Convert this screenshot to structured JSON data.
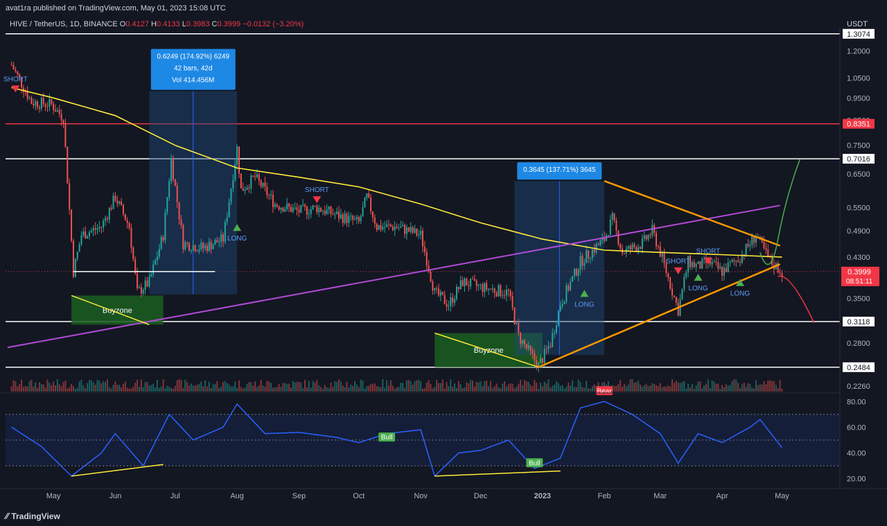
{
  "publish": {
    "text": "avat1ra published on TradingView.com, May 01, 2023 15:08 UTC"
  },
  "legend": {
    "symbol": "HIVE / TetherUS, 1D, BINANCE",
    "open_label": "O",
    "open": "0.4127",
    "high_label": "H",
    "high": "0.4133",
    "low_label": "L",
    "low": "0.3983",
    "close_label": "C",
    "close": "0.3999",
    "change": "−0.0132 (−3.20%)"
  },
  "currency": "USDT",
  "footer": {
    "brand": "TradingView",
    "logo_icon": "tradingview-logo-icon"
  },
  "colors": {
    "background": "#131722",
    "up": "#26a69a",
    "down": "#ef5350",
    "ema": "#ffeb3b",
    "trend_orange": "#ff9800",
    "trend_purple": "#b24bd6",
    "resistance": "#f23645",
    "rsi": "#2962ff"
  },
  "chart_data": [
    {
      "type": "candlestick",
      "title": "HIVE / TetherUS, 1D, BINANCE",
      "y_scale": "log",
      "ylim": [
        0.22,
        1.32
      ],
      "x_ticks": [
        "May",
        "Jun",
        "Jul",
        "Aug",
        "Sep",
        "Oct",
        "Nov",
        "Dec",
        "2023",
        "Feb",
        "Mar",
        "Apr",
        "May"
      ],
      "y_ticks": [
        "1.2000",
        "1.0500",
        "0.9500",
        "0.8500",
        "0.7500",
        "0.6500",
        "0.5500",
        "0.4900",
        "0.4300",
        "0.3500",
        "0.2800",
        "0.2260"
      ],
      "levels": [
        {
          "price": "1.3074",
          "value": 1.3074,
          "color": "#ffffff"
        },
        {
          "price": "0.8351",
          "value": 0.8351,
          "color": "#f23645"
        },
        {
          "price": "0.7016",
          "value": 0.7016,
          "color": "#ffffff"
        },
        {
          "price": "0.3118",
          "value": 0.3118,
          "color": "#ffffff"
        },
        {
          "price": "0.2484",
          "value": 0.2484,
          "color": "#ffffff"
        }
      ],
      "last_price": {
        "price": "0.3999",
        "countdown": "08:51:11"
      },
      "close_path": [
        [
          "2022-04-10",
          1.12
        ],
        [
          "2022-04-20",
          0.93
        ],
        [
          "2022-04-30",
          0.92
        ],
        [
          "2022-05-06",
          0.86
        ],
        [
          "2022-05-11",
          0.4
        ],
        [
          "2022-05-15",
          0.48
        ],
        [
          "2022-05-25",
          0.5
        ],
        [
          "2022-06-01",
          0.58
        ],
        [
          "2022-06-08",
          0.5
        ],
        [
          "2022-06-12",
          0.36
        ],
        [
          "2022-06-18",
          0.38
        ],
        [
          "2022-06-25",
          0.48
        ],
        [
          "2022-06-29",
          0.7
        ],
        [
          "2022-07-05",
          0.46
        ],
        [
          "2022-07-15",
          0.45
        ],
        [
          "2022-07-25",
          0.47
        ],
        [
          "2022-08-01",
          0.74
        ],
        [
          "2022-08-03",
          0.6
        ],
        [
          "2022-08-10",
          0.64
        ],
        [
          "2022-08-20",
          0.56
        ],
        [
          "2022-09-01",
          0.54
        ],
        [
          "2022-09-10",
          0.55
        ],
        [
          "2022-09-20",
          0.53
        ],
        [
          "2022-10-01",
          0.51
        ],
        [
          "2022-10-05",
          0.58
        ],
        [
          "2022-10-10",
          0.5
        ],
        [
          "2022-10-20",
          0.5
        ],
        [
          "2022-11-01",
          0.48
        ],
        [
          "2022-11-08",
          0.36
        ],
        [
          "2022-11-15",
          0.34
        ],
        [
          "2022-11-22",
          0.38
        ],
        [
          "2022-12-01",
          0.37
        ],
        [
          "2022-12-15",
          0.36
        ],
        [
          "2022-12-20",
          0.29
        ],
        [
          "2022-12-30",
          0.25
        ],
        [
          "2023-01-05",
          0.28
        ],
        [
          "2023-01-10",
          0.34
        ],
        [
          "2023-01-20",
          0.42
        ],
        [
          "2023-02-01",
          0.47
        ],
        [
          "2023-02-05",
          0.52
        ],
        [
          "2023-02-10",
          0.44
        ],
        [
          "2023-02-20",
          0.46
        ],
        [
          "2023-02-25",
          0.49
        ],
        [
          "2023-03-01",
          0.44
        ],
        [
          "2023-03-10",
          0.33
        ],
        [
          "2023-03-15",
          0.42
        ],
        [
          "2023-03-20",
          0.41
        ],
        [
          "2023-03-25",
          0.42
        ],
        [
          "2023-04-01",
          0.4
        ],
        [
          "2023-04-10",
          0.43
        ],
        [
          "2023-04-18",
          0.48
        ],
        [
          "2023-04-25",
          0.42
        ],
        [
          "2023-05-01",
          0.4
        ]
      ],
      "ema_yellow": [
        [
          "2022-04-10",
          1.0
        ],
        [
          "2022-05-01",
          0.95
        ],
        [
          "2022-06-01",
          0.87
        ],
        [
          "2022-07-01",
          0.75
        ],
        [
          "2022-08-01",
          0.67
        ],
        [
          "2022-09-01",
          0.64
        ],
        [
          "2022-10-01",
          0.61
        ],
        [
          "2022-11-01",
          0.56
        ],
        [
          "2022-12-01",
          0.51
        ],
        [
          "2023-01-01",
          0.47
        ],
        [
          "2023-02-01",
          0.445
        ],
        [
          "2023-03-01",
          0.44
        ],
        [
          "2023-04-01",
          0.435
        ],
        [
          "2023-05-01",
          0.43
        ]
      ],
      "measure_boxes": [
        {
          "label": "0.6249 (174.92%) 6249",
          "label2": "42 bars, 42d",
          "label3": "Vol 414.456M",
          "from": "2022-06-18",
          "to": "2022-08-01",
          "low": 0.357,
          "high": 0.982
        },
        {
          "label": "0.3645 (137.71%) 3645",
          "from": "2022-12-18",
          "to": "2023-02-01",
          "low": 0.264,
          "high": 0.628
        }
      ],
      "zones": [
        {
          "label": "Buyzone",
          "from": "2022-05-10",
          "to": "2022-06-25",
          "low": 0.307,
          "high": 0.355
        },
        {
          "label": "Buyzone",
          "from": "2022-11-08",
          "to": "2023-01-01",
          "low": 0.2484,
          "high": 0.2944
        }
      ],
      "signals": [
        {
          "label": "SHORT",
          "date": "2022-04-12",
          "price": 0.99,
          "dir": "down"
        },
        {
          "label": "LONG",
          "date": "2022-08-01",
          "price": 0.5,
          "dir": "up"
        },
        {
          "label": "SHORT",
          "date": "2022-09-10",
          "price": 0.57,
          "dir": "down"
        },
        {
          "label": "LONG",
          "date": "2023-01-22",
          "price": 0.36,
          "dir": "up"
        },
        {
          "label": "SHORT",
          "date": "2023-03-10",
          "price": 0.4,
          "dir": "down"
        },
        {
          "label": "LONG",
          "date": "2023-03-20",
          "price": 0.39,
          "dir": "up"
        },
        {
          "label": "SHORT",
          "date": "2023-03-25",
          "price": 0.42,
          "dir": "down"
        },
        {
          "label": "LONG",
          "date": "2023-04-10",
          "price": 0.38,
          "dir": "up"
        }
      ]
    },
    {
      "type": "line",
      "title": "RSI",
      "ylim": [
        15,
        85
      ],
      "y_ticks": [
        "80.00",
        "60.00",
        "40.00",
        "20.00"
      ],
      "band": [
        30,
        70
      ],
      "x": [
        "2022-04-10",
        "2022-04-25",
        "2022-05-10",
        "2022-05-25",
        "2022-06-01",
        "2022-06-15",
        "2022-06-28",
        "2022-07-10",
        "2022-07-25",
        "2022-08-01",
        "2022-08-15",
        "2022-09-01",
        "2022-09-20",
        "2022-10-01",
        "2022-10-15",
        "2022-11-01",
        "2022-11-08",
        "2022-11-20",
        "2022-12-01",
        "2022-12-15",
        "2022-12-28",
        "2023-01-10",
        "2023-01-20",
        "2023-02-01",
        "2023-02-15",
        "2023-03-01",
        "2023-03-10",
        "2023-03-20",
        "2023-04-01",
        "2023-04-15",
        "2023-04-20",
        "2023-05-01"
      ],
      "values": [
        60,
        45,
        22,
        40,
        55,
        30,
        70,
        50,
        60,
        78,
        55,
        56,
        52,
        48,
        55,
        58,
        22,
        40,
        42,
        50,
        28,
        36,
        75,
        80,
        70,
        55,
        32,
        55,
        48,
        60,
        66,
        44
      ],
      "annotations": [
        {
          "label": "Bear",
          "date": "2023-02-01",
          "value": 80,
          "color": "#f23645"
        },
        {
          "label": "Bull",
          "date": "2022-10-15",
          "value": 44,
          "color": "#4caf50"
        },
        {
          "label": "Bull",
          "date": "2022-12-28",
          "value": 24,
          "color": "#4caf50"
        }
      ]
    }
  ]
}
